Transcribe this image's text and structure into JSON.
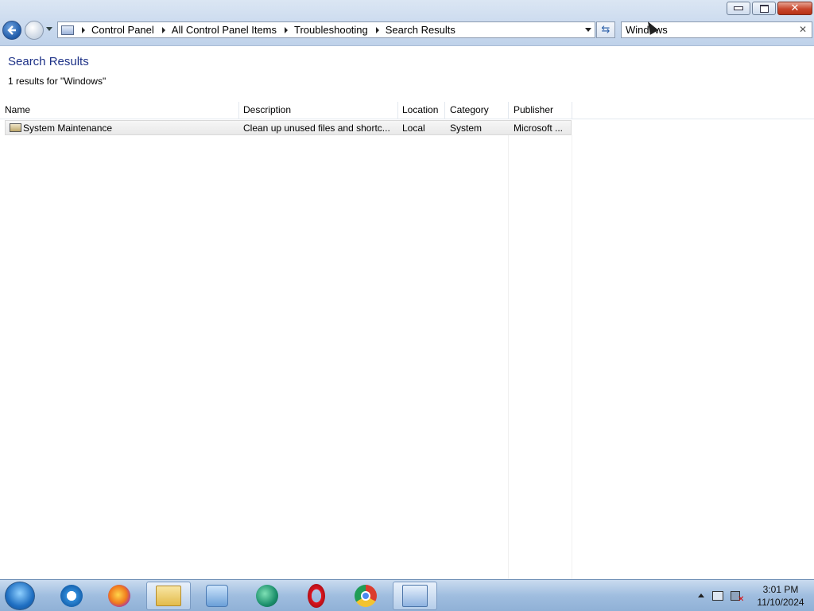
{
  "window": {
    "breadcrumbs": [
      "Control Panel",
      "All Control Panel Items",
      "Troubleshooting",
      "Search Results"
    ],
    "search_value": "Windows"
  },
  "content": {
    "title": "Search Results",
    "result_count": "1 results for \"Windows\"",
    "columns": [
      "Name",
      "Description",
      "Location",
      "Category",
      "Publisher"
    ],
    "rows": [
      {
        "name": "System Maintenance",
        "description": "Clean up unused files and shortc...",
        "location": "Local",
        "category": "System",
        "publisher": "Microsoft ..."
      }
    ]
  },
  "taskbar": {
    "apps": [
      "internet-explorer",
      "firefox",
      "file-explorer",
      "media-player",
      "green-app",
      "opera",
      "chrome",
      "control-panel"
    ],
    "active": [
      "file-explorer",
      "control-panel"
    ],
    "time": "3:01 PM",
    "date": "11/10/2024"
  }
}
